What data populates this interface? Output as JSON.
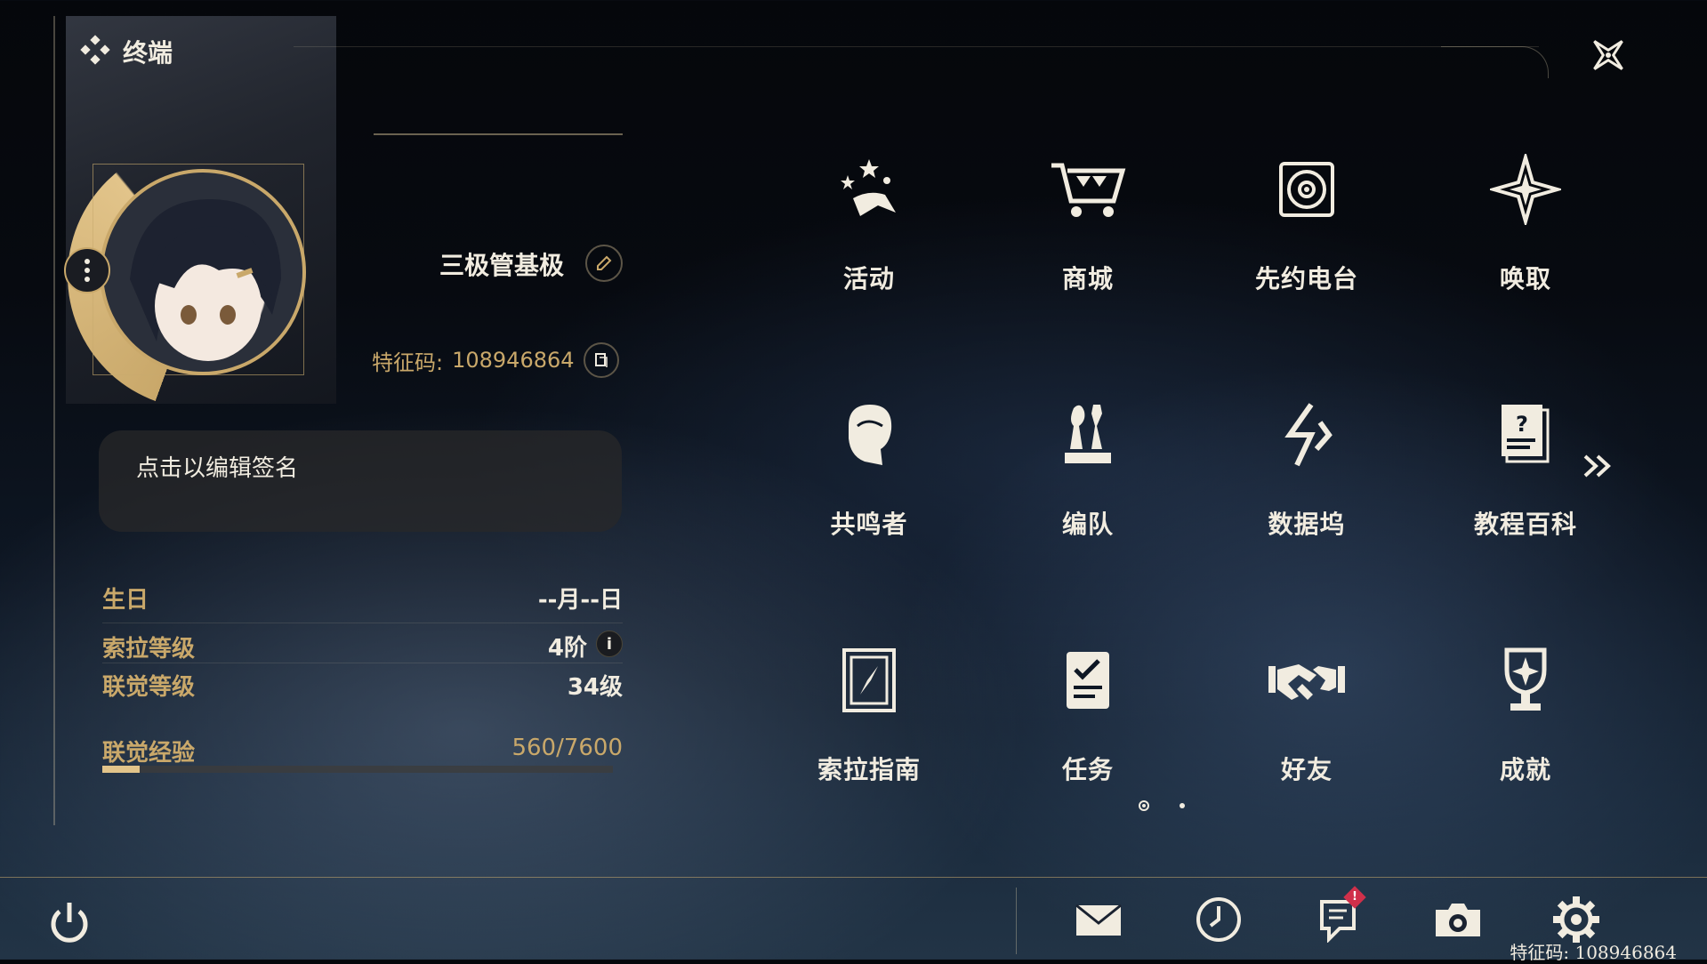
{
  "header": {
    "title": "终端"
  },
  "profile": {
    "name": "三极管基极",
    "uid_label": "特征码:",
    "uid_value": "108946864",
    "signature_placeholder": "点击以编辑签名"
  },
  "stats": {
    "birthday_label": "生日",
    "birthday_value": "--月--日",
    "sola_level_label": "索拉等级",
    "sola_level_value": "4阶",
    "union_level_label": "联觉等级",
    "union_level_value": "34级",
    "union_exp_label": "联觉经验",
    "union_exp_value": "560/7600",
    "union_exp_fraction": 0.0737
  },
  "menu": {
    "items": [
      {
        "label": "活动",
        "icon": "activity-icon"
      },
      {
        "label": "商城",
        "icon": "shop-cart-icon"
      },
      {
        "label": "先约电台",
        "icon": "radio-icon"
      },
      {
        "label": "唤取",
        "icon": "convene-icon"
      },
      {
        "label": "共鸣者",
        "icon": "resonator-icon"
      },
      {
        "label": "编队",
        "icon": "team-chess-icon"
      },
      {
        "label": "数据坞",
        "icon": "data-bank-icon"
      },
      {
        "label": "教程百科",
        "icon": "tutorial-icon"
      },
      {
        "label": "索拉指南",
        "icon": "guidebook-icon"
      },
      {
        "label": "任务",
        "icon": "quest-icon"
      },
      {
        "label": "好友",
        "icon": "friends-handshake-icon"
      },
      {
        "label": "成就",
        "icon": "achievement-trophy-icon"
      }
    ],
    "page_count": 2,
    "current_page": 1
  },
  "bottom_bar": {
    "icons": [
      "mail-icon",
      "clock-icon",
      "notice-icon",
      "camera-icon",
      "settings-gear-icon"
    ],
    "notice_badge": "!",
    "uid_footer": "特征码: 108946864"
  },
  "colors": {
    "accent": "#c9a86a",
    "text": "#f1ece0",
    "badge": "#d0304a"
  }
}
